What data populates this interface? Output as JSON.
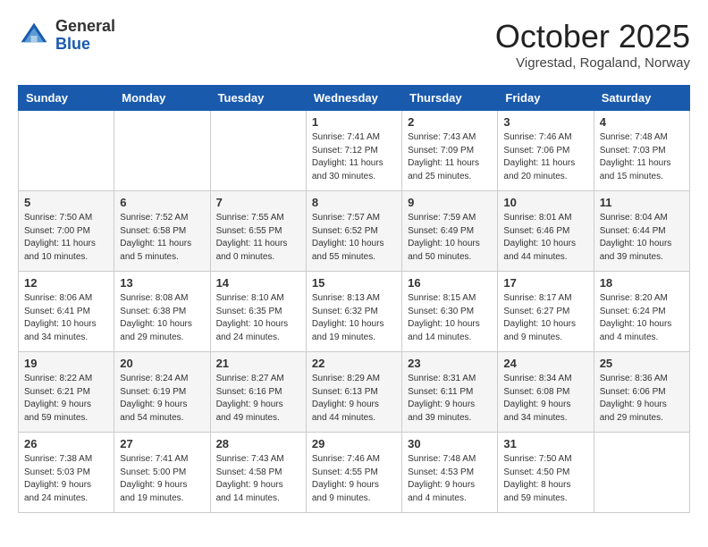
{
  "header": {
    "logo": {
      "general": "General",
      "blue": "Blue"
    },
    "title": "October 2025",
    "location": "Vigrestad, Rogaland, Norway"
  },
  "weekdays": [
    "Sunday",
    "Monday",
    "Tuesday",
    "Wednesday",
    "Thursday",
    "Friday",
    "Saturday"
  ],
  "weeks": [
    [
      {
        "day": "",
        "info": ""
      },
      {
        "day": "",
        "info": ""
      },
      {
        "day": "",
        "info": ""
      },
      {
        "day": "1",
        "info": "Sunrise: 7:41 AM\nSunset: 7:12 PM\nDaylight: 11 hours\nand 30 minutes."
      },
      {
        "day": "2",
        "info": "Sunrise: 7:43 AM\nSunset: 7:09 PM\nDaylight: 11 hours\nand 25 minutes."
      },
      {
        "day": "3",
        "info": "Sunrise: 7:46 AM\nSunset: 7:06 PM\nDaylight: 11 hours\nand 20 minutes."
      },
      {
        "day": "4",
        "info": "Sunrise: 7:48 AM\nSunset: 7:03 PM\nDaylight: 11 hours\nand 15 minutes."
      }
    ],
    [
      {
        "day": "5",
        "info": "Sunrise: 7:50 AM\nSunset: 7:00 PM\nDaylight: 11 hours\nand 10 minutes."
      },
      {
        "day": "6",
        "info": "Sunrise: 7:52 AM\nSunset: 6:58 PM\nDaylight: 11 hours\nand 5 minutes."
      },
      {
        "day": "7",
        "info": "Sunrise: 7:55 AM\nSunset: 6:55 PM\nDaylight: 11 hours\nand 0 minutes."
      },
      {
        "day": "8",
        "info": "Sunrise: 7:57 AM\nSunset: 6:52 PM\nDaylight: 10 hours\nand 55 minutes."
      },
      {
        "day": "9",
        "info": "Sunrise: 7:59 AM\nSunset: 6:49 PM\nDaylight: 10 hours\nand 50 minutes."
      },
      {
        "day": "10",
        "info": "Sunrise: 8:01 AM\nSunset: 6:46 PM\nDaylight: 10 hours\nand 44 minutes."
      },
      {
        "day": "11",
        "info": "Sunrise: 8:04 AM\nSunset: 6:44 PM\nDaylight: 10 hours\nand 39 minutes."
      }
    ],
    [
      {
        "day": "12",
        "info": "Sunrise: 8:06 AM\nSunset: 6:41 PM\nDaylight: 10 hours\nand 34 minutes."
      },
      {
        "day": "13",
        "info": "Sunrise: 8:08 AM\nSunset: 6:38 PM\nDaylight: 10 hours\nand 29 minutes."
      },
      {
        "day": "14",
        "info": "Sunrise: 8:10 AM\nSunset: 6:35 PM\nDaylight: 10 hours\nand 24 minutes."
      },
      {
        "day": "15",
        "info": "Sunrise: 8:13 AM\nSunset: 6:32 PM\nDaylight: 10 hours\nand 19 minutes."
      },
      {
        "day": "16",
        "info": "Sunrise: 8:15 AM\nSunset: 6:30 PM\nDaylight: 10 hours\nand 14 minutes."
      },
      {
        "day": "17",
        "info": "Sunrise: 8:17 AM\nSunset: 6:27 PM\nDaylight: 10 hours\nand 9 minutes."
      },
      {
        "day": "18",
        "info": "Sunrise: 8:20 AM\nSunset: 6:24 PM\nDaylight: 10 hours\nand 4 minutes."
      }
    ],
    [
      {
        "day": "19",
        "info": "Sunrise: 8:22 AM\nSunset: 6:21 PM\nDaylight: 9 hours\nand 59 minutes."
      },
      {
        "day": "20",
        "info": "Sunrise: 8:24 AM\nSunset: 6:19 PM\nDaylight: 9 hours\nand 54 minutes."
      },
      {
        "day": "21",
        "info": "Sunrise: 8:27 AM\nSunset: 6:16 PM\nDaylight: 9 hours\nand 49 minutes."
      },
      {
        "day": "22",
        "info": "Sunrise: 8:29 AM\nSunset: 6:13 PM\nDaylight: 9 hours\nand 44 minutes."
      },
      {
        "day": "23",
        "info": "Sunrise: 8:31 AM\nSunset: 6:11 PM\nDaylight: 9 hours\nand 39 minutes."
      },
      {
        "day": "24",
        "info": "Sunrise: 8:34 AM\nSunset: 6:08 PM\nDaylight: 9 hours\nand 34 minutes."
      },
      {
        "day": "25",
        "info": "Sunrise: 8:36 AM\nSunset: 6:06 PM\nDaylight: 9 hours\nand 29 minutes."
      }
    ],
    [
      {
        "day": "26",
        "info": "Sunrise: 7:38 AM\nSunset: 5:03 PM\nDaylight: 9 hours\nand 24 minutes."
      },
      {
        "day": "27",
        "info": "Sunrise: 7:41 AM\nSunset: 5:00 PM\nDaylight: 9 hours\nand 19 minutes."
      },
      {
        "day": "28",
        "info": "Sunrise: 7:43 AM\nSunset: 4:58 PM\nDaylight: 9 hours\nand 14 minutes."
      },
      {
        "day": "29",
        "info": "Sunrise: 7:46 AM\nSunset: 4:55 PM\nDaylight: 9 hours\nand 9 minutes."
      },
      {
        "day": "30",
        "info": "Sunrise: 7:48 AM\nSunset: 4:53 PM\nDaylight: 9 hours\nand 4 minutes."
      },
      {
        "day": "31",
        "info": "Sunrise: 7:50 AM\nSunset: 4:50 PM\nDaylight: 8 hours\nand 59 minutes."
      },
      {
        "day": "",
        "info": ""
      }
    ]
  ]
}
